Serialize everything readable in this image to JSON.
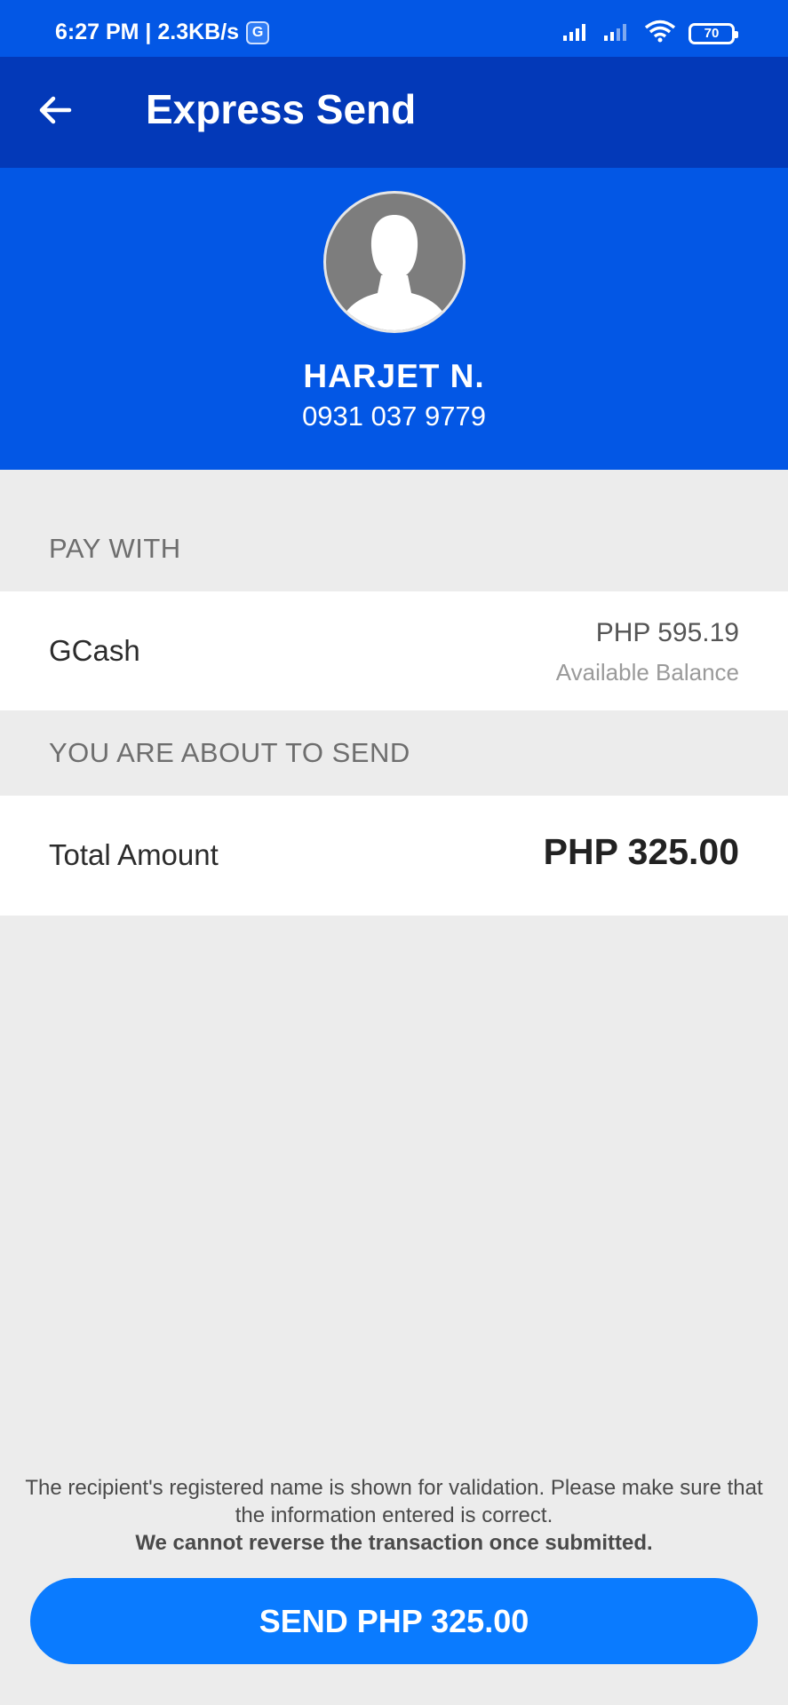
{
  "status_bar": {
    "time_speed": "6:27 PM | 2.3KB/s",
    "badge_letter": "G",
    "battery": "70"
  },
  "header": {
    "title": "Express Send"
  },
  "recipient": {
    "name": "HARJET N.",
    "number": "0931 037 9779"
  },
  "pay_with": {
    "label": "PAY WITH",
    "method": "GCash",
    "balance": "PHP 595.19",
    "balance_caption": "Available Balance"
  },
  "send_summary": {
    "label": "YOU ARE ABOUT TO SEND",
    "total_label": "Total Amount",
    "total_amount": "PHP 325.00"
  },
  "disclaimer": {
    "line1": "The recipient's registered name is shown for validation. Please make sure that the information entered is correct.",
    "line2": "We cannot reverse the transaction once submitted."
  },
  "send_button": {
    "label": "SEND PHP 325.00"
  },
  "colors": {
    "status_bar": "#0357e5",
    "app_bar": "#0339b8",
    "button": "#0a7bff"
  },
  "icons": {
    "back": "arrow-left-icon",
    "signal": "cell-signal-icon",
    "wifi": "wifi-icon",
    "battery": "battery-icon",
    "avatar": "user-silhouette-icon"
  }
}
